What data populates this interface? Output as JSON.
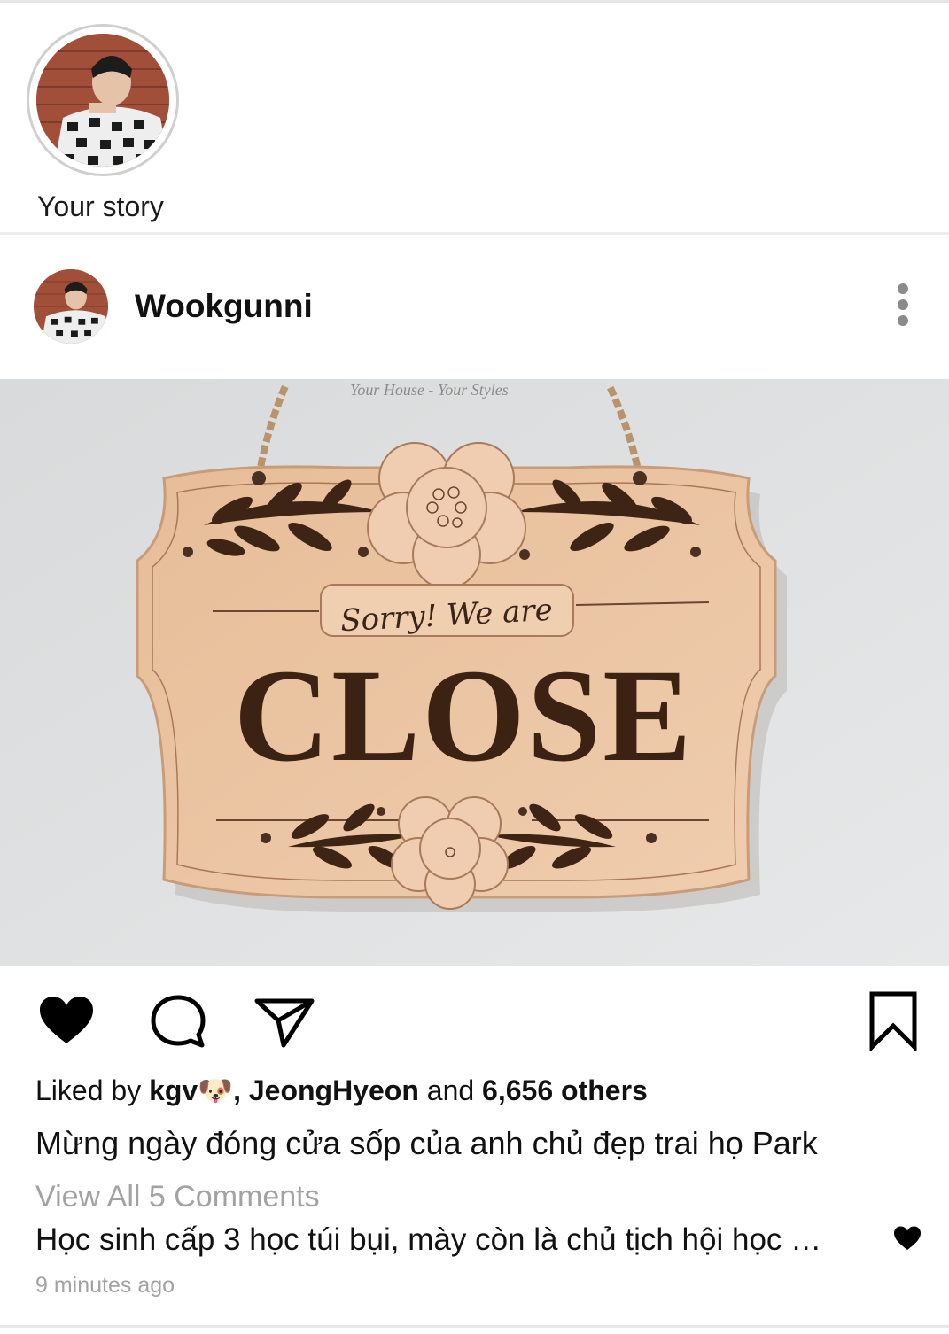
{
  "story": {
    "label": "Your story"
  },
  "post": {
    "username": "Wookgunni",
    "image": {
      "watermark": "Your House - Your Styles",
      "sign_top_text": "Sorry! We are",
      "sign_main_text": "CLOSE"
    },
    "likes": {
      "prefix": "Liked by ",
      "user1": "kgv🐶",
      "separator": ", ",
      "user2": "JeongHyeon",
      "and_text": " and ",
      "others": "6,656 others"
    },
    "caption": "Mừng ngày đóng cửa sốp của anh chủ đẹp trai họ Park",
    "view_all_comments": "View All 5 Comments",
    "top_comment": "Học sinh cấp 3 học túi bụi, mày còn là chủ tịch hội học …",
    "timestamp": "9 minutes ago"
  },
  "icons": {
    "like": "heart-filled-icon",
    "comment": "comment-bubble-icon",
    "share": "send-paper-plane-icon",
    "save": "bookmark-icon",
    "more": "more-vertical-icon",
    "comment_like": "heart-small-icon"
  },
  "colors": {
    "text": "#111111",
    "muted": "#a2a2a2",
    "sign_wood": "#e8bf9c",
    "sign_ink": "#3b2213"
  }
}
